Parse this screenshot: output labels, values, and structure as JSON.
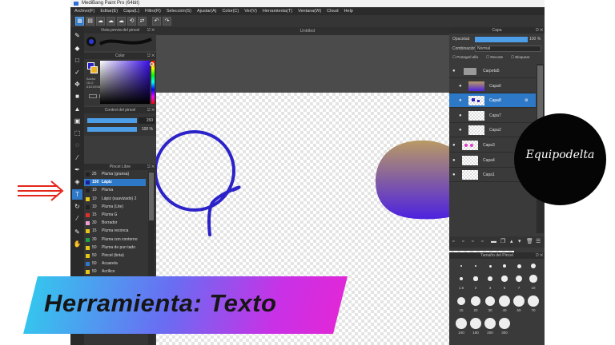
{
  "window": {
    "title": "MediBang Paint Pro (64bit)",
    "menu": [
      "Archivo(F)",
      "Editar(E)",
      "Capa(L)",
      "Filtro(R)",
      "Selección(S)",
      "Ajustar(A)",
      "Color(C)",
      "Ver(V)",
      "Herramienta(T)",
      "Ventana(W)",
      "Cloud",
      "Help"
    ]
  },
  "canvas": {
    "tab_title": "Untitled"
  },
  "panels": {
    "brush_preview": {
      "title": "Vista previa del pincel"
    },
    "color": {
      "title": "Color",
      "labels": [
        "Ancho",
        "OLO",
        "#1D1E9A"
      ]
    },
    "brush_control": {
      "title": "Control del pincel",
      "size": "150",
      "opacity": "100 %"
    },
    "brush_list": {
      "title": "Pincel Libre",
      "rows": [
        {
          "size": "25",
          "name": "Pluma (gruesa)",
          "color": "#222222"
        },
        {
          "size": "150",
          "name": "Lápiz",
          "color": "#1d1e9a",
          "selected": true
        },
        {
          "size": "10",
          "name": "Pluma",
          "color": "#222222"
        },
        {
          "size": "10",
          "name": "Lápiz (suavizado) 2",
          "color": "#e6c619"
        },
        {
          "size": "10",
          "name": "Pluma (Lite)",
          "color": "#222222"
        },
        {
          "size": "15",
          "name": "Pluma G",
          "color": "#e0302c"
        },
        {
          "size": "30",
          "name": "Borrador",
          "color": "#f0a0d0"
        },
        {
          "size": "15",
          "name": "Pluma reconca",
          "color": "#e6c619"
        },
        {
          "size": "30",
          "name": "Pluma con contorno",
          "color": "#21a04a"
        },
        {
          "size": "50",
          "name": "Pluma de pun tado",
          "color": "#e6c619"
        },
        {
          "size": "50",
          "name": "Pincel (tinta)",
          "color": "#e6c619"
        },
        {
          "size": "50",
          "name": "Acuarela",
          "color": "#2e79c7"
        },
        {
          "size": "50",
          "name": "Acrílico",
          "color": "#e6c619"
        },
        {
          "size": "100",
          "name": "Aerógrafo",
          "color": "#e6c619"
        },
        {
          "size": "150",
          "name": "Candy",
          "color": "#2e79c7"
        },
        {
          "size": "150",
          "name": "Halloween",
          "color": "#2e79c7"
        }
      ]
    },
    "layers": {
      "title": "Capa",
      "opacity_label": "Opacidad",
      "opacity_value": "100 %",
      "blend_label": "Combinación",
      "blend_value": "Normal",
      "options": [
        "Protegerl alfa",
        "Recorte",
        "Bloquear"
      ],
      "rows": [
        {
          "name": "Carpeta5",
          "indent": 0,
          "type": "folder"
        },
        {
          "name": "Capa6",
          "indent": 1,
          "type": "gradient"
        },
        {
          "name": "Capa8",
          "indent": 1,
          "type": "dots",
          "selected": true
        },
        {
          "name": "Capa7",
          "indent": 1,
          "type": "plain"
        },
        {
          "name": "Capa2",
          "indent": 1,
          "type": "plain"
        },
        {
          "name": "Capa3",
          "indent": 0,
          "type": "pink"
        },
        {
          "name": "Capa4",
          "indent": 0,
          "type": "plain"
        },
        {
          "name": "Capa1",
          "indent": 0,
          "type": "plain"
        }
      ]
    },
    "brush_size": {
      "title": "Tamaño del Pincel",
      "labels": [
        "1.5",
        "2",
        "3",
        "5",
        "7",
        "10",
        "15",
        "20",
        "30",
        "40",
        "50",
        "70",
        "100",
        "150",
        "200",
        "300"
      ]
    }
  },
  "overlay": {
    "caption": "Herramienta: Texto",
    "logo": "Equipodelta"
  },
  "colors": {
    "stroke": "#2b22c8",
    "accent": "#2e79c7",
    "blob_top": "#b99a64",
    "blob_bottom": "#4d22e0"
  }
}
